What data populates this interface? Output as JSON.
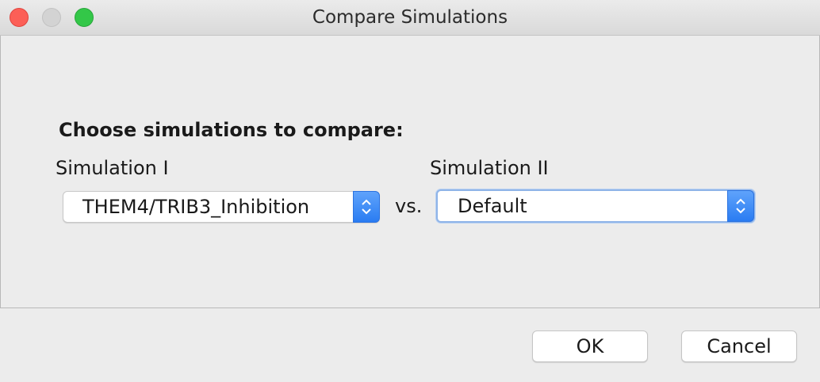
{
  "window": {
    "title": "Compare Simulations"
  },
  "form": {
    "heading": "Choose simulations to compare:",
    "simulation1_label": "Simulation I",
    "simulation2_label": "Simulation II",
    "simulation1_value": "THEM4/TRIB3_Inhibition",
    "simulation2_value": "Default",
    "vs_label": "vs."
  },
  "buttons": {
    "ok_label": "OK",
    "cancel_label": "Cancel"
  },
  "icons": {
    "close": "close-traffic-light",
    "minimize": "minimize-traffic-light",
    "zoom": "zoom-traffic-light",
    "stepper": "up-down-chevron-icon"
  },
  "colors": {
    "accent": "#2a7cf2",
    "close": "#fc5f57",
    "zoom": "#33c748"
  }
}
